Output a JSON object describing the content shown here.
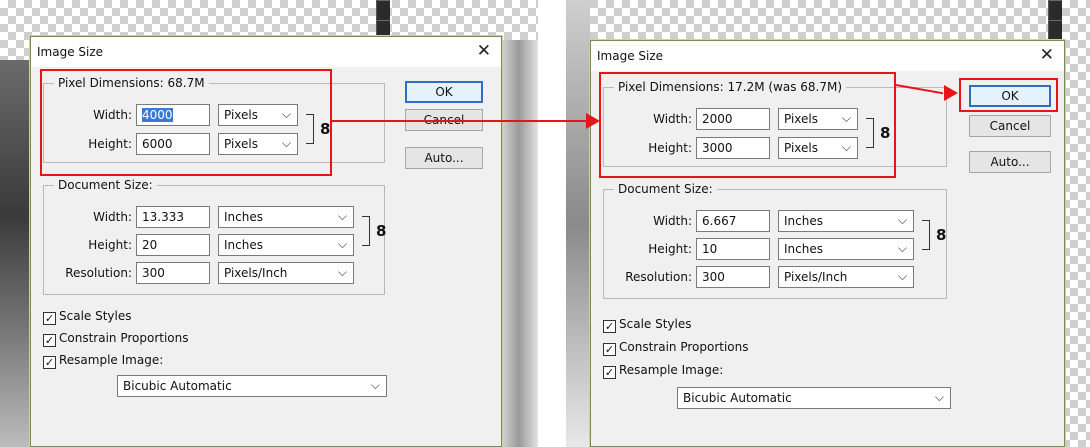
{
  "left": {
    "title": "Image Size",
    "close_glyph": "✕",
    "pixel_dimensions_label": "Pixel Dimensions:",
    "pixel_dimensions_value": "68.7M",
    "pd_width_label": "Width:",
    "pd_width_value": "4000",
    "pd_width_unit": "Pixels",
    "pd_height_label": "Height:",
    "pd_height_value": "6000",
    "pd_height_unit": "Pixels",
    "ok_label": "OK",
    "cancel_label": "Cancel",
    "auto_label": "Auto...",
    "document_size_label": "Document Size:",
    "ds_width_label": "Width:",
    "ds_width_value": "13.333",
    "ds_width_unit": "Inches",
    "ds_height_label": "Height:",
    "ds_height_value": "20",
    "ds_height_unit": "Inches",
    "resolution_label": "Resolution:",
    "resolution_value": "300",
    "resolution_unit": "Pixels/Inch",
    "scale_styles": "Scale Styles",
    "constrain_proportions": "Constrain Proportions",
    "resample_image": "Resample Image:",
    "resample_method": "Bicubic Automatic"
  },
  "right": {
    "title": "Image Size",
    "close_glyph": "✕",
    "pixel_dimensions_label": "Pixel Dimensions:",
    "pixel_dimensions_value": "17.2M (was 68.7M)",
    "pd_width_label": "Width:",
    "pd_width_value": "2000",
    "pd_width_unit": "Pixels",
    "pd_height_label": "Height:",
    "pd_height_value": "3000",
    "pd_height_unit": "Pixels",
    "ok_label": "OK",
    "cancel_label": "Cancel",
    "auto_label": "Auto...",
    "document_size_label": "Document Size:",
    "ds_width_label": "Width:",
    "ds_width_value": "6.667",
    "ds_width_unit": "Inches",
    "ds_height_label": "Height:",
    "ds_height_value": "10",
    "ds_height_unit": "Inches",
    "resolution_label": "Resolution:",
    "resolution_value": "300",
    "resolution_unit": "Pixels/Inch",
    "scale_styles": "Scale Styles",
    "constrain_proportions": "Constrain Proportions",
    "resample_image": "Resample Image:",
    "resample_method": "Bicubic Automatic"
  },
  "glyphs": {
    "check": "✓",
    "chevron": "⌵",
    "chain": "8"
  },
  "colors": {
    "highlight": "#e8141a",
    "selection": "#3b78d8",
    "ok_border": "#2f6cc4"
  }
}
